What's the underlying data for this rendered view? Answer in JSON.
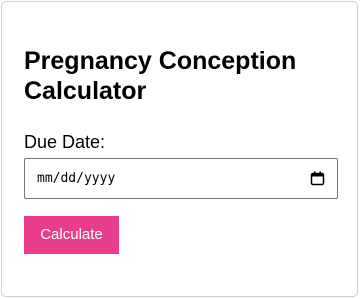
{
  "form": {
    "title": "Pregnancy Conception Calculator",
    "due_date_label": "Due Date:",
    "due_date_placeholder": "mm/dd/yyyy",
    "calendar_icon": "calendar-icon",
    "calculate_label": "Calculate"
  },
  "colors": {
    "button_background": "#e83e8c",
    "button_text": "#ffffff",
    "card_border": "#cfcfcf"
  }
}
